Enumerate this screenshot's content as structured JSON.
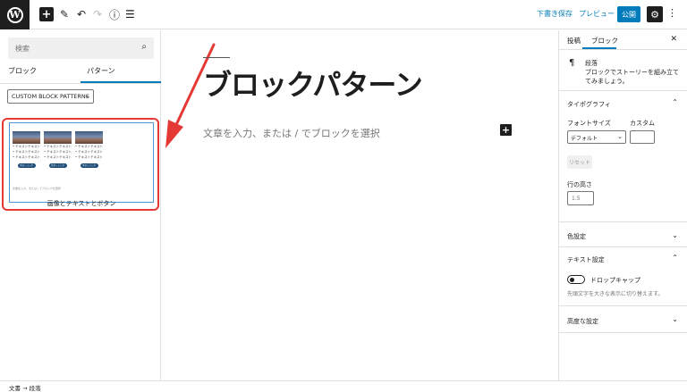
{
  "topbar": {
    "logo_letter": "W",
    "add_icon": "+",
    "edit_icon": "✎",
    "undo_icon": "↶",
    "redo_icon": "↷",
    "info_icon": "ⓘ",
    "list_icon": "☰",
    "save_draft_label": "下書き保存",
    "preview_label": "プレビュー",
    "publish_label": "公開",
    "settings_icon": "⚙",
    "more_icon": "⋮"
  },
  "inserter": {
    "search_placeholder": "検索",
    "search_icon": "⌕",
    "tabs": [
      "ブロック",
      "パターン"
    ],
    "category_label": "CUSTOM BLOCK PATTERNS",
    "chevron": "⌄",
    "pattern": {
      "item_lines": [
        "• テキストテキスト",
        "• テキストテキスト",
        "• テキストテキスト"
      ],
      "button_text": "ボタンリンク",
      "note": "文章を入力、または / でブロックを選択",
      "title": "画像とテキストとボタン"
    }
  },
  "editor": {
    "title": "ブロックパターン",
    "placeholder": "文章を入力、または / でブロックを選択",
    "add_block_icon": "+"
  },
  "sidebar": {
    "tabs": [
      "投稿",
      "ブロック"
    ],
    "close_icon": "✕",
    "block_icon": "¶",
    "block_name": "段落",
    "block_description": "ブロックでストーリーを組み立ててみましょう。",
    "typography_title": "タイポグラフィ",
    "font_size_label": "フォントサイズ",
    "custom_label": "カスタム",
    "font_size_value": "デフォルト",
    "reset_label": "リセット",
    "line_height_label": "行の高さ",
    "line_height_placeholder": "1.5",
    "color_title": "色設定",
    "text_settings_title": "テキスト設定",
    "drop_cap_label": "ドロップキャップ",
    "drop_cap_help": "先頭文字を大きな表示に切り替えます。",
    "advanced_title": "高度な設定",
    "chevron_up": "⌃",
    "chevron_down": "⌄"
  },
  "footer": {
    "breadcrumb": "文書 → 段落"
  },
  "colors": {
    "accent": "#007cba",
    "highlight": "#e53935"
  }
}
